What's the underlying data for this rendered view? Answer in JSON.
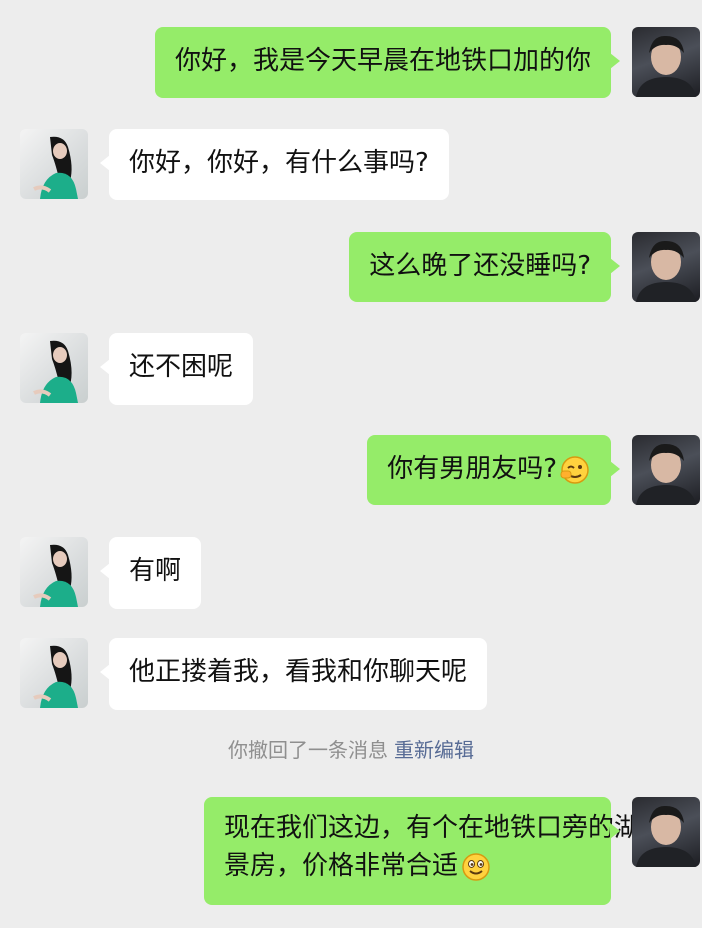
{
  "messages": [
    {
      "from": "me",
      "text": "你好，我是今天早晨在地铁口加的你"
    },
    {
      "from": "her",
      "text": "你好，你好，有什么事吗?"
    },
    {
      "from": "me",
      "text": "这么晚了还没睡吗?"
    },
    {
      "from": "her",
      "text": "还不困呢"
    },
    {
      "from": "me",
      "text": "你有男朋友吗?",
      "emoji": "wink-hand-emoji"
    },
    {
      "from": "her",
      "text": "有啊"
    },
    {
      "from": "her",
      "text": "他正搂着我，看我和你聊天呢"
    },
    {
      "from": "me",
      "line1": "现在我们这边，有个在地铁口旁的湖",
      "line2": "景房，价格非常合适",
      "emoji": "smile-emoji"
    }
  ],
  "system_notice": {
    "text": "你撤回了一条消息",
    "action": "重新编辑"
  },
  "colors": {
    "background": "#ededed",
    "my_bubble": "#95ec69",
    "her_bubble": "#ffffff",
    "link": "#576b95"
  }
}
